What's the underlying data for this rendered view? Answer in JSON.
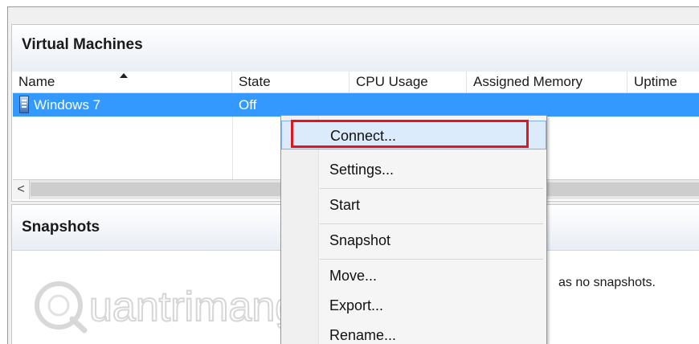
{
  "vm_pane": {
    "title": "Virtual Machines",
    "columns": [
      "Name",
      "State",
      "CPU Usage",
      "Assigned Memory",
      "Uptime"
    ],
    "rows": [
      {
        "name": "Windows 7",
        "state": "Off"
      }
    ],
    "scroll_left": "<"
  },
  "snapshots_pane": {
    "title": "Snapshots",
    "empty_message": "as no snapshots."
  },
  "context_menu": {
    "items": [
      "Connect...",
      "Settings...",
      "Start",
      "Snapshot",
      "Move...",
      "Export...",
      "Rename..."
    ]
  },
  "watermark": {
    "text": "uantrimang"
  },
  "colors": {
    "selection": "#3399ff",
    "highlight_box": "#e3141c",
    "menu_hover": "#dcebfb"
  },
  "icons": [
    "sort-ascending-icon",
    "virtual-machine-icon",
    "scroll-left-icon",
    "watermark-logo-icon"
  ]
}
